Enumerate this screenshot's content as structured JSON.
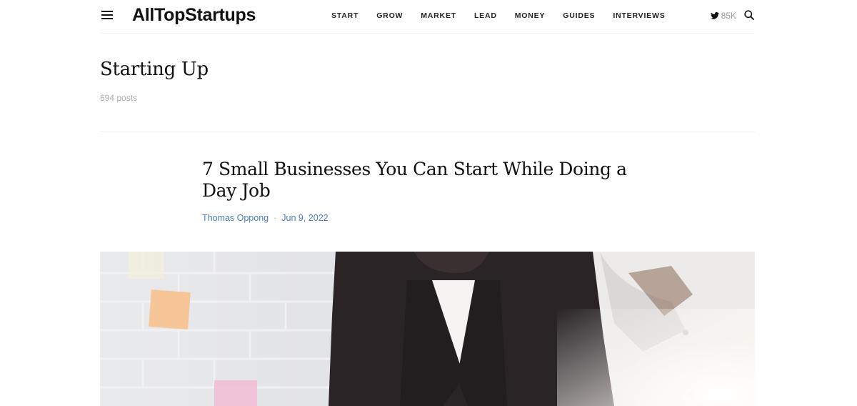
{
  "header": {
    "logo": "AllTopStartups",
    "nav": [
      "START",
      "GROW",
      "MARKET",
      "LEAD",
      "MONEY",
      "GUIDES",
      "INTERVIEWS"
    ],
    "twitter_count": "85K",
    "icons": {
      "menu": "hamburger-menu-icon",
      "twitter": "twitter-icon",
      "search": "search-icon"
    }
  },
  "archive": {
    "title": "Starting Up",
    "count": "694 posts"
  },
  "article": {
    "title": "7 Small Businesses You Can Start While Doing a Day Job",
    "author": "Thomas Oppong",
    "separator": "·",
    "date": "Jun 9, 2022"
  },
  "colors": {
    "meta_link": "#4a7fbf",
    "divider": "#eeeeee",
    "muted": "#aaaaaa"
  }
}
